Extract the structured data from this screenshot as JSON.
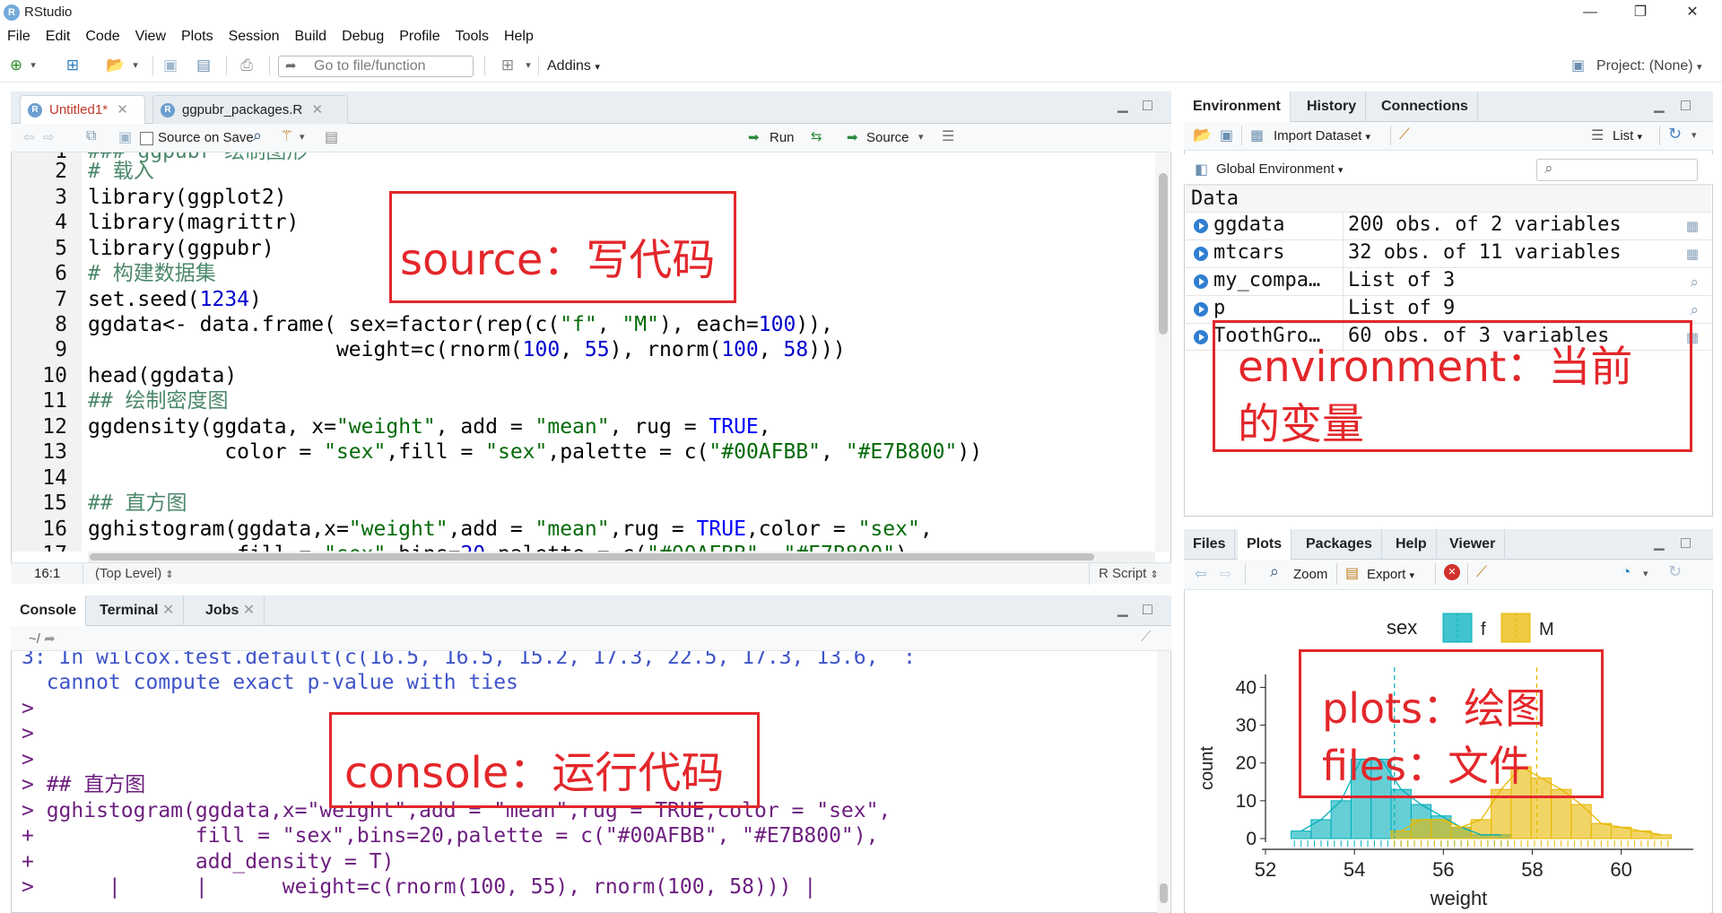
{
  "window": {
    "title": "RStudio",
    "controls": [
      "—",
      "❐",
      "✕"
    ]
  },
  "menu": [
    "File",
    "Edit",
    "Code",
    "View",
    "Plots",
    "Session",
    "Build",
    "Debug",
    "Profile",
    "Tools",
    "Help"
  ],
  "toolbar": {
    "goto_placeholder": "Go to file/function",
    "addins": "Addins",
    "project": "Project: (None)"
  },
  "source": {
    "tabs": [
      "Untitled1*",
      "ggpubr_packages.R"
    ],
    "source_on_save": "Source on Save",
    "run": "Run",
    "source_btn": "Source",
    "line_numbers": [
      "1",
      "2",
      "3",
      "4",
      "5",
      "6",
      "7",
      "8",
      "9",
      "10",
      "11",
      "12",
      "13",
      "14",
      "15",
      "16",
      "17"
    ],
    "cursor": "16:1",
    "scope": "(Top Level)",
    "filetype": "R Script"
  },
  "console": {
    "tabs": [
      "Console",
      "Terminal",
      "Jobs"
    ],
    "path": "~/",
    "lines": [
      "3: In wilcox.test.default(c(16.5, 16.5, 15.2, 17.3, 22.5, 17.3, 13.6,  :",
      "  cannot compute exact p-value with ties",
      ">",
      ">",
      ">",
      "> ## 直方图",
      "> gghistogram(ggdata,x=\"weight\",add = \"mean\",rug = TRUE,color = \"sex\",",
      "+             fill = \"sex\",bins=20,palette = c(\"#00AFBB\", \"#E7B800\"),",
      "+             add_density = T)",
      ">      |      |      weight=c(rnorm(100, 55), rnorm(100, 58))) |"
    ]
  },
  "environment": {
    "tabs": [
      "Environment",
      "History",
      "Connections"
    ],
    "import_dataset": "Import Dataset",
    "list_view": "List",
    "scope": "Global Environment",
    "section": "Data",
    "rows": [
      {
        "name": "ggdata",
        "value": "200 obs. of 2 variables",
        "icon": "grid-icon"
      },
      {
        "name": "mtcars",
        "value": "32 obs. of 11 variables",
        "icon": "grid-icon"
      },
      {
        "name": "my_compa…",
        "value": "List of 3",
        "icon": "search-icon"
      },
      {
        "name": "p",
        "value": "List of 9",
        "icon": "search-icon"
      },
      {
        "name": "ToothGro…",
        "value": "60 obs. of 3 variables",
        "icon": "grid-icon"
      }
    ]
  },
  "plots": {
    "tabs": [
      "Files",
      "Plots",
      "Packages",
      "Help",
      "Viewer"
    ],
    "zoom": "Zoom",
    "export": "Export"
  },
  "chart_data": {
    "type": "bar",
    "xlabel": "weight",
    "ylabel": "count",
    "xlim": [
      52,
      61.5
    ],
    "ylim": [
      0,
      42
    ],
    "xticks": [
      "52",
      "54",
      "56",
      "58",
      "60"
    ],
    "yticks": [
      "0",
      "10",
      "20",
      "30",
      "40"
    ],
    "legend": {
      "title": "sex",
      "entries": [
        "f",
        "M"
      ],
      "position": "top"
    },
    "colors": {
      "f": "#00AFBB",
      "M": "#E7B800"
    },
    "bin_width": 0.45,
    "series": [
      {
        "name": "f",
        "bins": [
          [
            52.8,
            2
          ],
          [
            53.25,
            5
          ],
          [
            53.7,
            10
          ],
          [
            54.15,
            21
          ],
          [
            54.6,
            21
          ],
          [
            55.05,
            13
          ],
          [
            55.5,
            9
          ],
          [
            55.95,
            6
          ],
          [
            56.4,
            3
          ],
          [
            56.85,
            1
          ],
          [
            57.3,
            1
          ]
        ]
      },
      {
        "name": "M",
        "bins": [
          [
            55.05,
            2
          ],
          [
            55.5,
            5
          ],
          [
            55.95,
            5
          ],
          [
            56.4,
            3
          ],
          [
            56.85,
            5
          ],
          [
            57.3,
            13
          ],
          [
            57.75,
            19
          ],
          [
            58.2,
            16
          ],
          [
            58.65,
            13
          ],
          [
            59.1,
            9
          ],
          [
            59.55,
            4
          ],
          [
            60,
            3
          ],
          [
            60.45,
            2
          ],
          [
            60.9,
            1
          ]
        ]
      }
    ],
    "means": {
      "f": 54.9,
      "M": 58.1
    }
  },
  "annotations": [
    {
      "text": "source：写代码"
    },
    {
      "text": "environment：当前"
    },
    {
      "text": "的变量"
    },
    {
      "text": "console：运行代码"
    },
    {
      "text": "plots：绘图"
    },
    {
      "text": "files：文件"
    }
  ]
}
